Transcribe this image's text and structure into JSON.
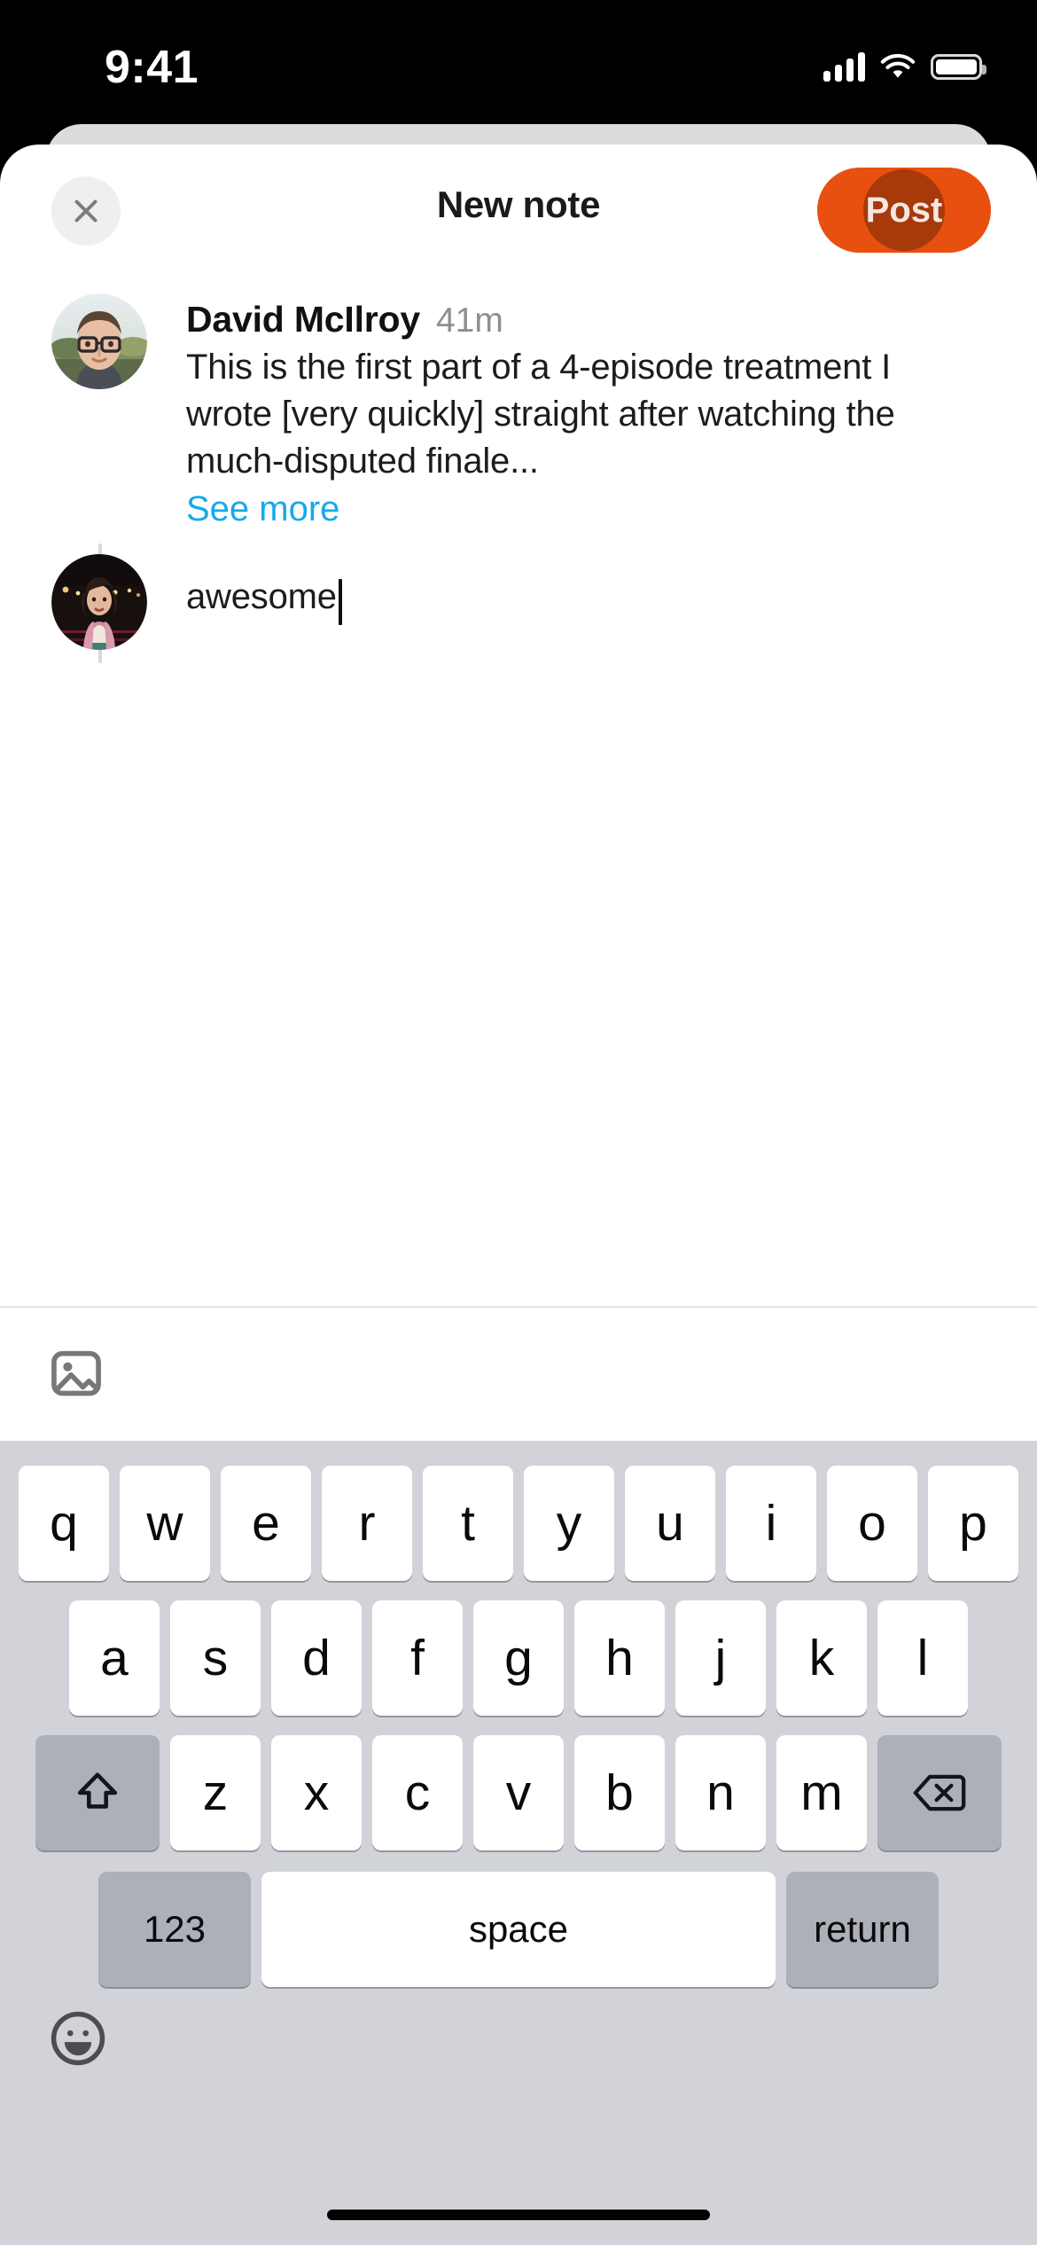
{
  "status_bar": {
    "time": "9:41",
    "cellular_icon": "cellular-bars-icon",
    "wifi_icon": "wifi-icon",
    "battery_icon": "battery-full-icon"
  },
  "header": {
    "title": "New note",
    "close_icon": "close-x-icon",
    "post_label": "Post",
    "post_color": "#E8500F"
  },
  "thread": {
    "original_post": {
      "author": "David McIlroy",
      "timestamp": "41m",
      "text": "This is the first part of a 4-episode treatment I wrote [very quickly] straight after watching the much-disputed finale...",
      "see_more_label": "See more",
      "see_more_color": "#17A9E8",
      "avatar_name": "avatar-david-mcilroy"
    },
    "reply": {
      "text": "awesome",
      "avatar_name": "avatar-current-user",
      "has_caret": true
    }
  },
  "toolbar": {
    "image_icon": "photo-attachment-icon"
  },
  "keyboard": {
    "row1": [
      "q",
      "w",
      "e",
      "r",
      "t",
      "y",
      "u",
      "i",
      "o",
      "p"
    ],
    "row2": [
      "a",
      "s",
      "d",
      "f",
      "g",
      "h",
      "j",
      "k",
      "l"
    ],
    "row3": [
      "z",
      "x",
      "c",
      "v",
      "b",
      "n",
      "m"
    ],
    "shift_icon": "shift-arrow-icon",
    "delete_icon": "backspace-delete-icon",
    "numbers_label": "123",
    "space_label": "space",
    "return_label": "return",
    "emoji_icon": "emoji-smiley-icon",
    "background_color": "#D1D3D8"
  },
  "home_indicator": "home-indicator-bar"
}
